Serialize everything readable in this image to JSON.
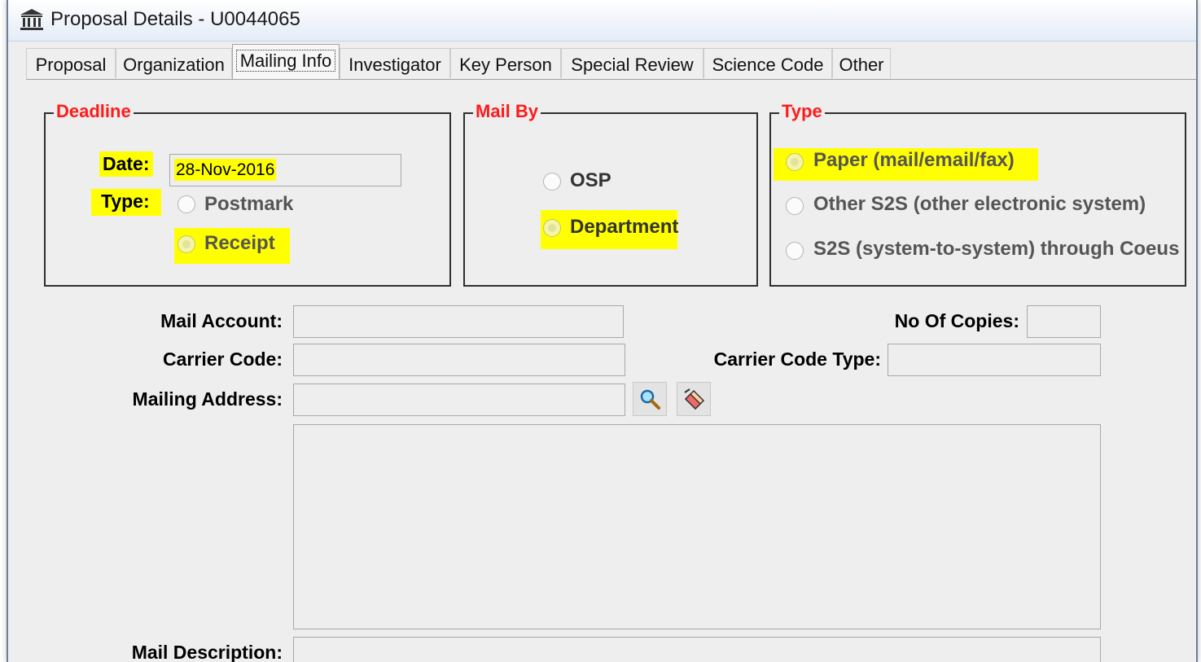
{
  "window": {
    "title": "Proposal Details - U0044065"
  },
  "tabs": [
    {
      "label": "Proposal"
    },
    {
      "label": "Organization"
    },
    {
      "label": "Mailing Info"
    },
    {
      "label": "Investigator"
    },
    {
      "label": "Key Person"
    },
    {
      "label": "Special Review"
    },
    {
      "label": "Science Code"
    },
    {
      "label": "Other"
    }
  ],
  "active_tab": "Mailing Info",
  "deadline": {
    "legend": "Deadline",
    "date_label": "Date:",
    "date_value": "28-Nov-2016",
    "type_label": "Type:",
    "options": [
      {
        "label": "Postmark",
        "selected": false
      },
      {
        "label": "Receipt",
        "selected": true
      }
    ]
  },
  "mail_by": {
    "legend": "Mail By",
    "options": [
      {
        "label": "OSP",
        "selected": false
      },
      {
        "label": "Department",
        "selected": true
      }
    ]
  },
  "type_group": {
    "legend": "Type",
    "options": [
      {
        "label": "Paper (mail/email/fax)",
        "selected": true
      },
      {
        "label": "Other S2S (other electronic system)",
        "selected": false
      },
      {
        "label": "S2S (system-to-system) through Coeus",
        "selected": false
      }
    ]
  },
  "form": {
    "mail_account_label": "Mail Account:",
    "mail_account_value": "",
    "no_of_copies_label": "No Of Copies:",
    "no_of_copies_value": "",
    "carrier_code_label": "Carrier Code:",
    "carrier_code_value": "",
    "carrier_code_type_label": "Carrier Code Type:",
    "carrier_code_type_value": "",
    "mailing_address_label": "Mailing Address:",
    "mailing_address_value": "",
    "mailing_address_text": "",
    "mail_description_label": "Mail Description:",
    "mail_description_value": ""
  },
  "colors": {
    "legend": "#ff1a1a",
    "highlight": "#ffff00",
    "background": "#eeeeee"
  },
  "icons": [
    "building-icon",
    "search-icon",
    "eraser-icon"
  ]
}
